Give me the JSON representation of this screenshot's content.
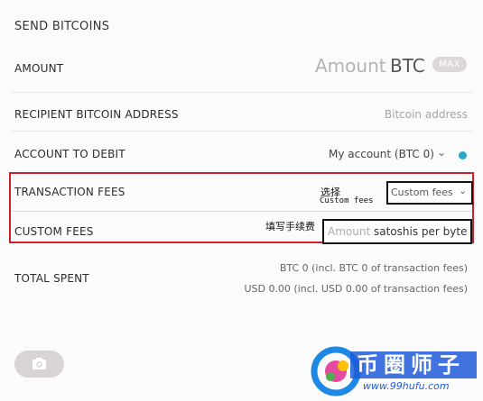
{
  "header": {
    "title": "SEND BITCOINS"
  },
  "amount": {
    "label": "AMOUNT",
    "placeholder": "Amount",
    "unit": "BTC",
    "max_label": "MAX"
  },
  "recipient": {
    "label": "RECIPIENT BITCOIN ADDRESS",
    "placeholder": "Bitcoin address"
  },
  "account": {
    "label": "ACCOUNT TO DEBIT",
    "value": "My account (BTC 0)",
    "status_color": "#27a9c6"
  },
  "fees": {
    "label": "TRANSACTION FEES",
    "selected": "Custom fees",
    "annotation_cn": "选择",
    "annotation_en": "Custom fees"
  },
  "custom_fees": {
    "label": "CUSTOM FEES",
    "annotation_cn": "填写手续费",
    "placeholder": "Amount",
    "unit": "satoshis per byte"
  },
  "total": {
    "label": "TOTAL SPENT",
    "btc_line": "BTC 0 (incl. BTC 0 of transaction fees)",
    "usd_line": "USD 0.00 (incl. USD 0.00 of transaction fees)"
  },
  "camera": {
    "icon": "camera-icon"
  },
  "watermark": {
    "text_cn": "币圈师子",
    "url": "www.99hufu.com"
  },
  "colors": {
    "highlight_border": "#c8232c",
    "accent": "#27a9c6"
  }
}
